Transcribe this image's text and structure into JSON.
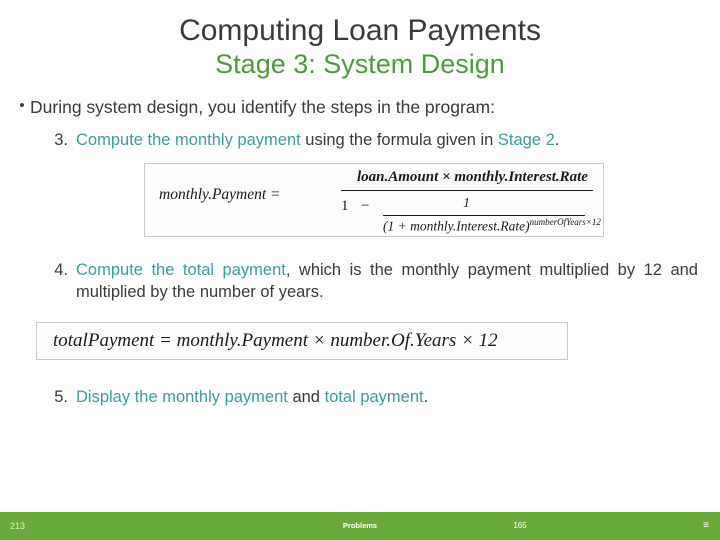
{
  "slide": {
    "title_line1": "Computing Loan Payments",
    "title_line2": "Stage 3: System Design",
    "bullet_marker": "•",
    "bullet_text": "During system design, you identify the steps in the program:",
    "items": [
      {
        "number": "3.",
        "green_part": "Compute the monthly payment",
        "rest": " using the formula given in ",
        "green_tail": "Stage 2",
        "tail": "."
      },
      {
        "number": "4.",
        "green_part": "Compute the total payment",
        "rest": ", which is the monthly payment multiplied by 12 and multiplied by the number of years.",
        "green_tail": "",
        "tail": ""
      },
      {
        "number": "5.",
        "green_part": "Display the monthly payment",
        "rest": " and ",
        "green_tail": "total payment",
        "tail": "."
      }
    ],
    "formula1": {
      "lhs": "monthly.Payment  =",
      "numerator": "loan.Amount  ×  monthly.Interest.Rate",
      "one": "1",
      "minus": "−",
      "frac_numerator": "1",
      "frac_denominator_base": "(1  +  monthly.Interest.Rate)",
      "frac_denominator_exp": "numberOfYears×12"
    },
    "formula2": {
      "text": "totalPayment  =  monthly.Payment  ×  number.Of.Years  ×  12"
    }
  },
  "footer": {
    "left_label": "213",
    "center_label": "Problems",
    "page_number": "165",
    "menu_icon": "≡"
  },
  "colors": {
    "title_dark": "#3a3a3a",
    "title_green": "#4f9a41",
    "accent_green": "#63a644",
    "accent_teal": "#3f9c9c",
    "footer_bar": "#6aaa3c"
  }
}
